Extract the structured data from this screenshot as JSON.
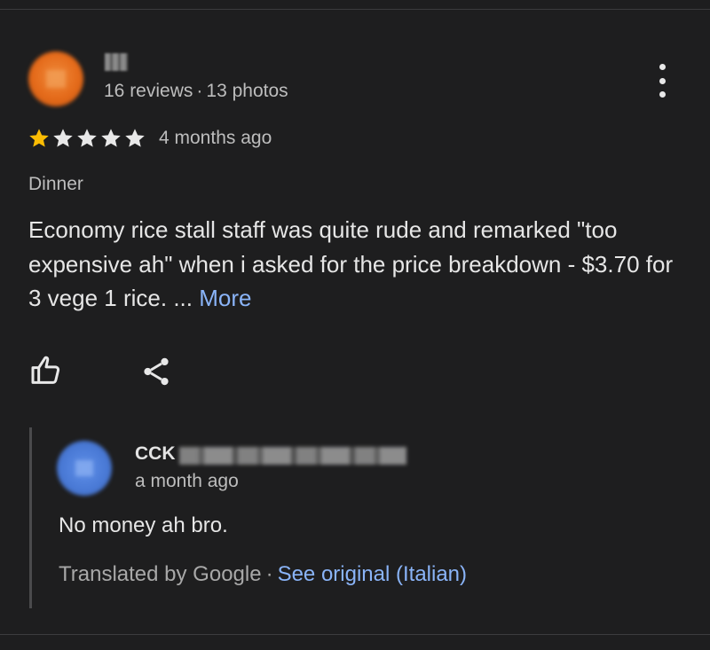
{
  "review": {
    "author_meta": {
      "reviews": "16 reviews",
      "separator": "·",
      "photos": "13 photos"
    },
    "rating": {
      "value": 1,
      "max": 5
    },
    "time": "4 months ago",
    "tag": "Dinner",
    "text": "Economy rice stall staff was quite rude and remarked \"too expensive ah\" when i asked for the price breakdown - $3.70 for 3 vege 1 rice. ...",
    "more_label": "More",
    "actions": {
      "like_icon": "thumbs-up-icon",
      "share_icon": "share-icon",
      "menu_icon": "more-vert-icon"
    }
  },
  "reply": {
    "name": "CCK",
    "time": "a month ago",
    "text": "No money ah bro.",
    "translated_label": "Translated by Google",
    "separator": "·",
    "see_original_label": "See original (Italian)"
  },
  "colors": {
    "background": "#1e1e1f",
    "star_filled": "#fbbc04",
    "star_empty": "#e8e8e8",
    "link": "#8ab4f8"
  }
}
